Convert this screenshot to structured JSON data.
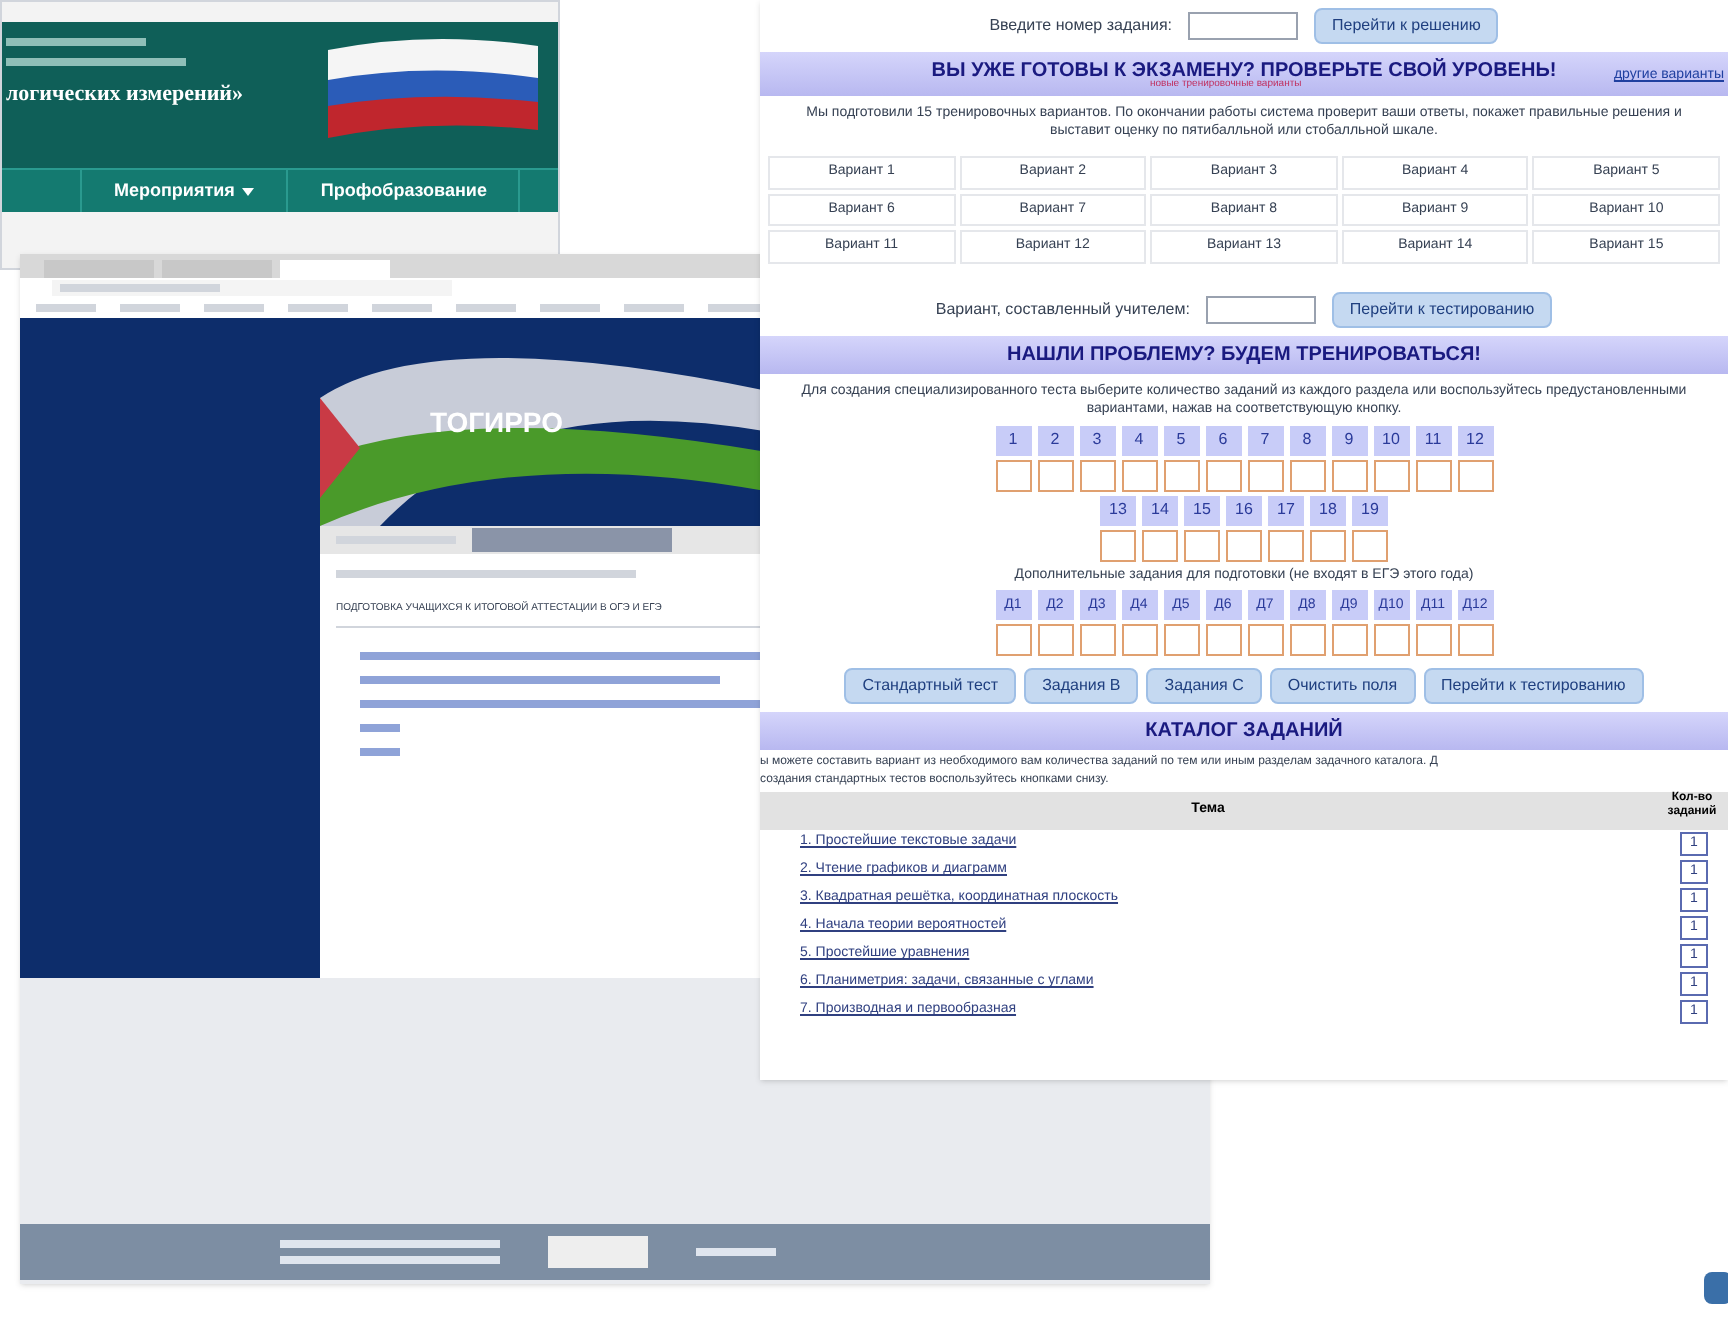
{
  "header_window": {
    "org_line": "логических измерений»",
    "menu": [
      {
        "label": "Мероприятия",
        "dropdown": true
      },
      {
        "label": "Профобразование",
        "dropdown": false
      }
    ]
  },
  "portal_window": {
    "tabs": [
      {
        "selected": false
      },
      {
        "selected": false
      },
      {
        "selected": true
      }
    ],
    "logo": "ТОГИРРО",
    "page_title": "ПОДГОТОВКА УЧАЩИХСЯ К ИТОГОВОЙ АТТЕСТАЦИИ В ОГЭ И ЕГЭ"
  },
  "exam_page": {
    "task_number": {
      "label": "Введите номер задания:",
      "button": "Перейти к решению"
    },
    "check_section": {
      "title": "ВЫ УЖЕ ГОТОВЫ К ЭКЗАМЕНУ? ПРОВЕРЬТЕ СВОЙ УРОВЕНЬ!",
      "note": "новые тренировочные варианты",
      "link": "другие варианты",
      "text": "Мы подготовили 15 тренировочных вариантов. По окончании работы система проверит ваши ответы, покажет правильные решения и выставит оценку по пятибалльной или стобалльной шкале.",
      "variants": [
        "Вариант 1",
        "Вариант 2",
        "Вариант 3",
        "Вариант 4",
        "Вариант 5",
        "Вариант 6",
        "Вариант 7",
        "Вариант 8",
        "Вариант 9",
        "Вариант 10",
        "Вариант 11",
        "Вариант 12",
        "Вариант 13",
        "Вариант 14",
        "Вариант 15"
      ],
      "teacher_label": "Вариант, составленный учителем:",
      "teacher_button": "Перейти к тестированию"
    },
    "training_section": {
      "title": "НАШЛИ ПРОБЛЕМУ? БУДЕМ ТРЕНИРОВАТЬСЯ!",
      "text": "Для создания специализированного теста выберите количество заданий из каждого раздела или воспользуйтесь предустановленными вариантами, нажав на соответствующую кнопку.",
      "task_groups": [
        [
          "1",
          "2",
          "3",
          "4",
          "5",
          "6",
          "7",
          "8",
          "9",
          "10",
          "11",
          "12"
        ],
        [
          "13",
          "14",
          "15",
          "16",
          "17",
          "18",
          "19"
        ]
      ],
      "extra_label": "Дополнительные задания для подготовки (не входят в ЕГЭ этого года)",
      "extra_tasks": [
        "Д1",
        "Д2",
        "Д3",
        "Д4",
        "Д5",
        "Д6",
        "Д7",
        "Д8",
        "Д9",
        "Д10",
        "Д11",
        "Д12"
      ],
      "buttons": [
        "Стандартный тест",
        "Задания B",
        "Задания C",
        "Очистить поля",
        "Перейти к тестированию"
      ]
    },
    "catalog": {
      "title": "КАТАЛОГ ЗАДАНИЙ",
      "text": "ы можете составить вариант из необходимого вам количества заданий по тем или иным разделам задачного каталога. Д",
      "text2": "создания стандартных тестов воспользуйтесь кнопками снизу.",
      "columns": [
        "Тема",
        "Кол-во заданий"
      ],
      "rows": [
        {
          "topic": "1. Простейшие текстовые задачи",
          "count": "1"
        },
        {
          "topic": "2. Чтение графиков и диаграмм",
          "count": "1"
        },
        {
          "topic": "3. Квадратная решётка, координатная плоскость",
          "count": "1"
        },
        {
          "topic": "4. Начала теории вероятностей",
          "count": "1"
        },
        {
          "topic": "5. Простейшие уравнения",
          "count": "1"
        },
        {
          "topic": "6. Планиметрия: задачи, связанные с углами",
          "count": "1"
        },
        {
          "topic": "7. Производная и первообразная",
          "count": "1"
        }
      ]
    }
  }
}
